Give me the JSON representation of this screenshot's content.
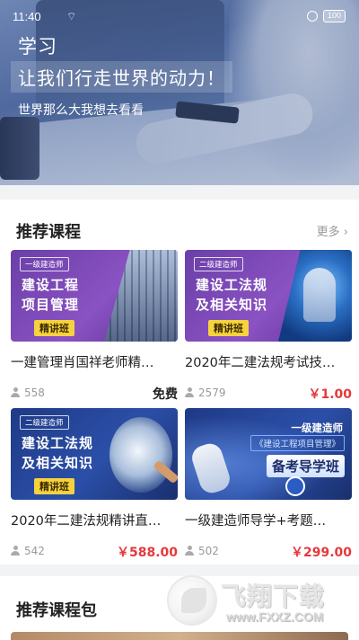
{
  "status_bar": {
    "time": "11:40",
    "battery": "100"
  },
  "hero": {
    "title": "学习",
    "slogan": "让我们行走世界的动力！",
    "subtitle": "世界那么大我想去看看"
  },
  "recommended_courses": {
    "section_title": "推荐课程",
    "more_label": "更多 ›",
    "courses": [
      {
        "name": "一建管理肖国祥老师精…",
        "learners": "558",
        "price": "免费",
        "thumb": {
          "badge": "一级建造师",
          "line1": "建设工程",
          "line2": "项目管理",
          "tag": "精讲班"
        }
      },
      {
        "name": "2020年二建法规考试技…",
        "learners": "2579",
        "price": "￥1.00",
        "thumb": {
          "badge": "二级建造师",
          "line1": "建设工法规",
          "line2": "及相关知识",
          "tag": "精讲班"
        }
      },
      {
        "name": "2020年二建法规精讲直…",
        "learners": "542",
        "price": "￥588.00",
        "thumb": {
          "badge": "二级建造师",
          "line1": "建设工法规",
          "line2": "及相关知识",
          "tag": "精讲班"
        }
      },
      {
        "name": "一级建造师导学+考题…",
        "learners": "502",
        "price": "￥299.00",
        "thumb": {
          "badge": "一级建造师",
          "line1": "《建设工程项目管理》",
          "line2": "备考导学班"
        }
      }
    ]
  },
  "course_packages": {
    "section_title": "推荐课程包"
  },
  "watermark": {
    "brand": "飞翔下载",
    "url": "www.FXXZ.COM"
  },
  "colors": {
    "price_red": "#e4393c",
    "page_bg": "#f2f3f5"
  }
}
